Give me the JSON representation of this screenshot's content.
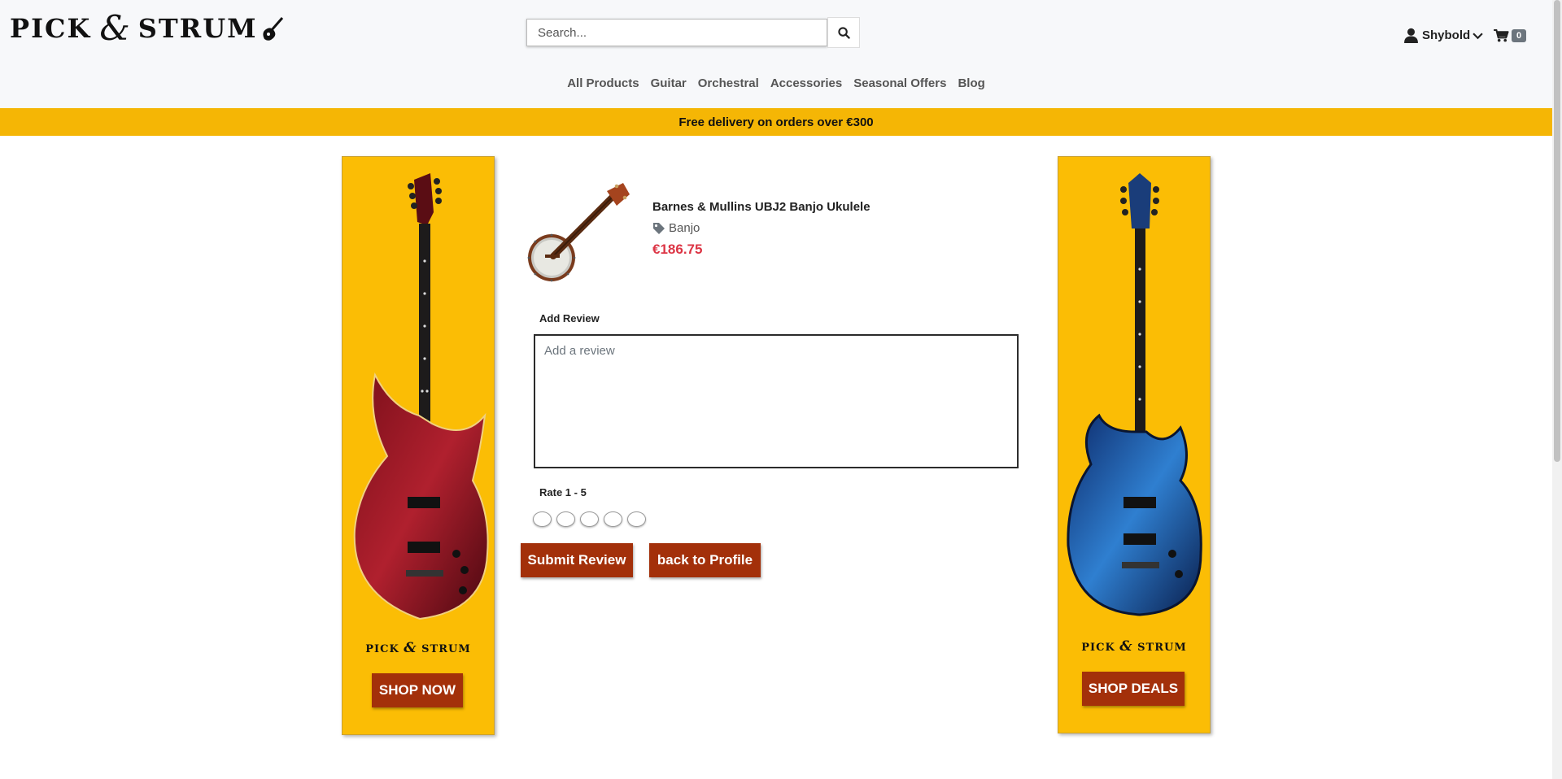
{
  "brand": {
    "part1": "PICK",
    "amp": "&",
    "part2": "STRUM"
  },
  "search": {
    "placeholder": "Search...",
    "value": ""
  },
  "account": {
    "username": "Shybold"
  },
  "cart": {
    "count": "0"
  },
  "nav": {
    "items": [
      {
        "label": "All Products"
      },
      {
        "label": "Guitar"
      },
      {
        "label": "Orchestral"
      },
      {
        "label": "Accessories"
      },
      {
        "label": "Seasonal Offers"
      },
      {
        "label": "Blog"
      }
    ]
  },
  "promo": {
    "text": "Free delivery on orders over €300"
  },
  "ads": {
    "left": {
      "brand1": "PICK",
      "amp": "&",
      "brand2": "STRUM",
      "button": "SHOP NOW"
    },
    "right": {
      "brand1": "PICK",
      "amp": "&",
      "brand2": "STRUM",
      "button": "SHOP DEALS"
    }
  },
  "product": {
    "name": "Barnes & Mullins UBJ2 Banjo Ukulele",
    "category": "Banjo",
    "price": "€186.75"
  },
  "review": {
    "label": "Add Review",
    "placeholder": "Add a review",
    "value": ""
  },
  "rating": {
    "label": "Rate 1 - 5",
    "max": 5,
    "selected": 0
  },
  "actions": {
    "submit": "Submit Review",
    "back": "back to Profile"
  },
  "colors": {
    "accent_yellow": "#f5b605",
    "button_red": "#a3300a",
    "price_red": "#dc3545"
  }
}
